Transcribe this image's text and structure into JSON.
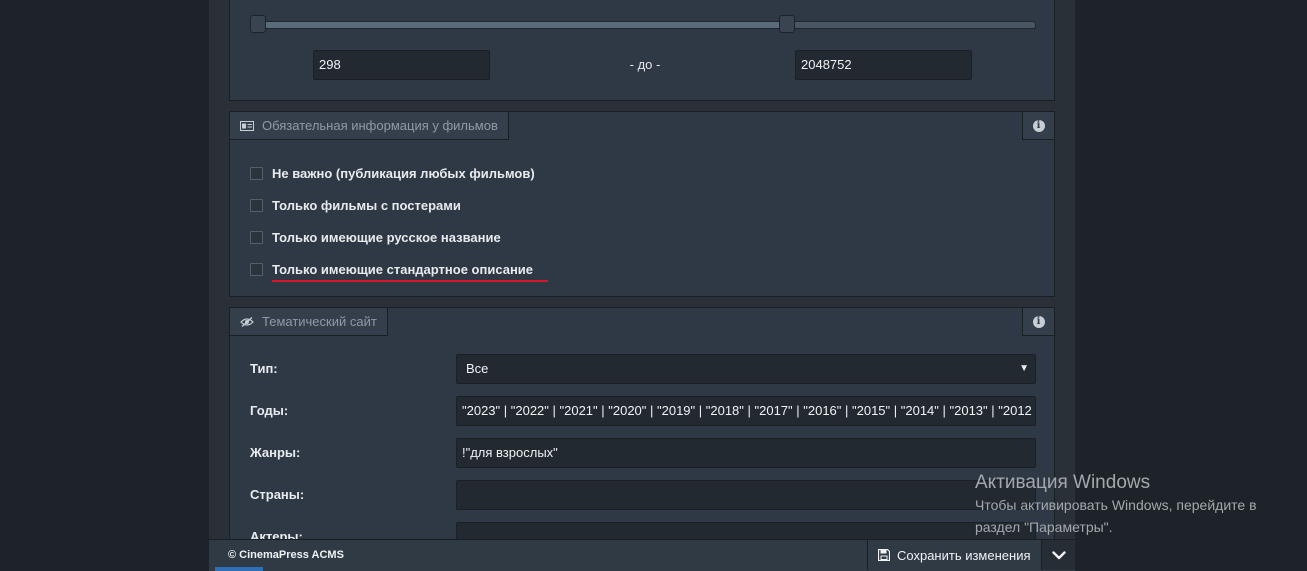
{
  "range": {
    "min_value": "298",
    "separator": "- до -",
    "max_value": "2048752",
    "min_fraction": 0.0,
    "max_fraction": 0.683
  },
  "filters": {
    "title": "Обязательная информация у фильмов",
    "options": [
      {
        "label": "Не важно (публикация любых фильмов)",
        "checked": false
      },
      {
        "label": "Только фильмы с постерами",
        "checked": false
      },
      {
        "label": "Только имеющие русское название",
        "checked": false
      },
      {
        "label": "Только имеющие стандартное описание",
        "checked": false
      }
    ]
  },
  "theme": {
    "title": "Тематический сайт",
    "fields": [
      {
        "label": "Тип:",
        "value": "Все"
      },
      {
        "label": "Годы:",
        "value": "\"2023\" | \"2022\" | \"2021\" | \"2020\" | \"2019\" | \"2018\" | \"2017\" | \"2016\" | \"2015\" | \"2014\" | \"2013\" | \"2012"
      },
      {
        "label": "Жанры:",
        "value": "!\"для взрослых\""
      },
      {
        "label": "Страны:",
        "value": ""
      },
      {
        "label": "Актеры:",
        "value": ""
      }
    ]
  },
  "footer": {
    "brand": "© CinemaPress ACMS",
    "save_label": "Сохранить изменения"
  },
  "watermark": {
    "title": "Активация Windows",
    "line1": "Чтобы активировать Windows, перейдите в",
    "line2": "раздел \"Параметры\"."
  },
  "colors": {
    "accent_underline": "#d7152b",
    "page_bg": "#2a3038",
    "panel_bg": "#2f3945"
  },
  "icons": [
    "id-card-icon",
    "eye-slash-icon",
    "info-icon",
    "save-icon",
    "chevron-down-icon"
  ]
}
